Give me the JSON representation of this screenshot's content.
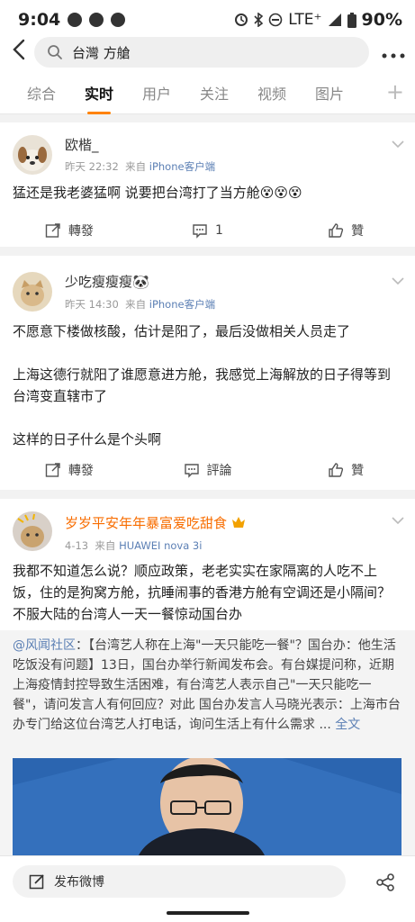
{
  "status_bar": {
    "time": "9:04",
    "network": "LTE⁺",
    "battery": "90%"
  },
  "search": {
    "query": "台灣 方艙"
  },
  "tabs": [
    {
      "label": "综合"
    },
    {
      "label": "实时"
    },
    {
      "label": "用户"
    },
    {
      "label": "关注"
    },
    {
      "label": "视频"
    },
    {
      "label": "图片"
    }
  ],
  "tab_add": "+",
  "posts": [
    {
      "user": "欧楷_",
      "time": "昨天 22:32",
      "source_prefix": "来自",
      "source": "iPhone客户端",
      "text": "猛还是我老婆猛啊 说要把台湾打了当方舱😵😵😵",
      "repost_label": "轉發",
      "comment_label": "1",
      "like_label": "贊"
    },
    {
      "user": "少吃瘦瘦瘦🐼",
      "time": "昨天 14:30",
      "source_prefix": "来自",
      "source": "iPhone客户端",
      "text_lines": [
        "不愿意下楼做核酸，估计是阳了，最后没做相关人员走了",
        "",
        "上海这德行就阳了谁愿意进方舱，我感觉上海解放的日子得等到台湾变直辖市了",
        "",
        "这样的日子什么是个头啊"
      ],
      "repost_label": "轉發",
      "comment_label": "評論",
      "like_label": "贊"
    },
    {
      "user": "岁岁平安年年暴富爱吃甜食",
      "time": "4-13",
      "source_prefix": "来自",
      "source": "HUAWEI nova 3i",
      "text": "我都不知道怎么说？顺应政策，老老实实在家隔离的人吃不上饭，住的是狗窝方舱，抗睡闹事的香港方舱有空调还是小隔间？不服大陆的台湾人一天一餐惊动国台办",
      "repost_user": "@风闻社区",
      "repost_text": "：【台湾艺人称在上海\"一天只能吃一餐\"？国台办：他生活吃饭没有问题】13日，国台办举行新闻发布会。有台媒提问称，近期上海疫情封控导致生活困难，有台湾艺人表示自己\"一天只能吃一餐\"，请问发言人有何回应？对此 国台办发言人马晓光表示：上海市台办专门给这位台湾艺人打电话，询问生活上有什么需求 ...",
      "repost_more": "全文"
    }
  ],
  "compose_label": "发布微博",
  "colors": {
    "accent": "#ff8200",
    "link": "#5b7fb4",
    "vip_name": "#f86d00"
  }
}
